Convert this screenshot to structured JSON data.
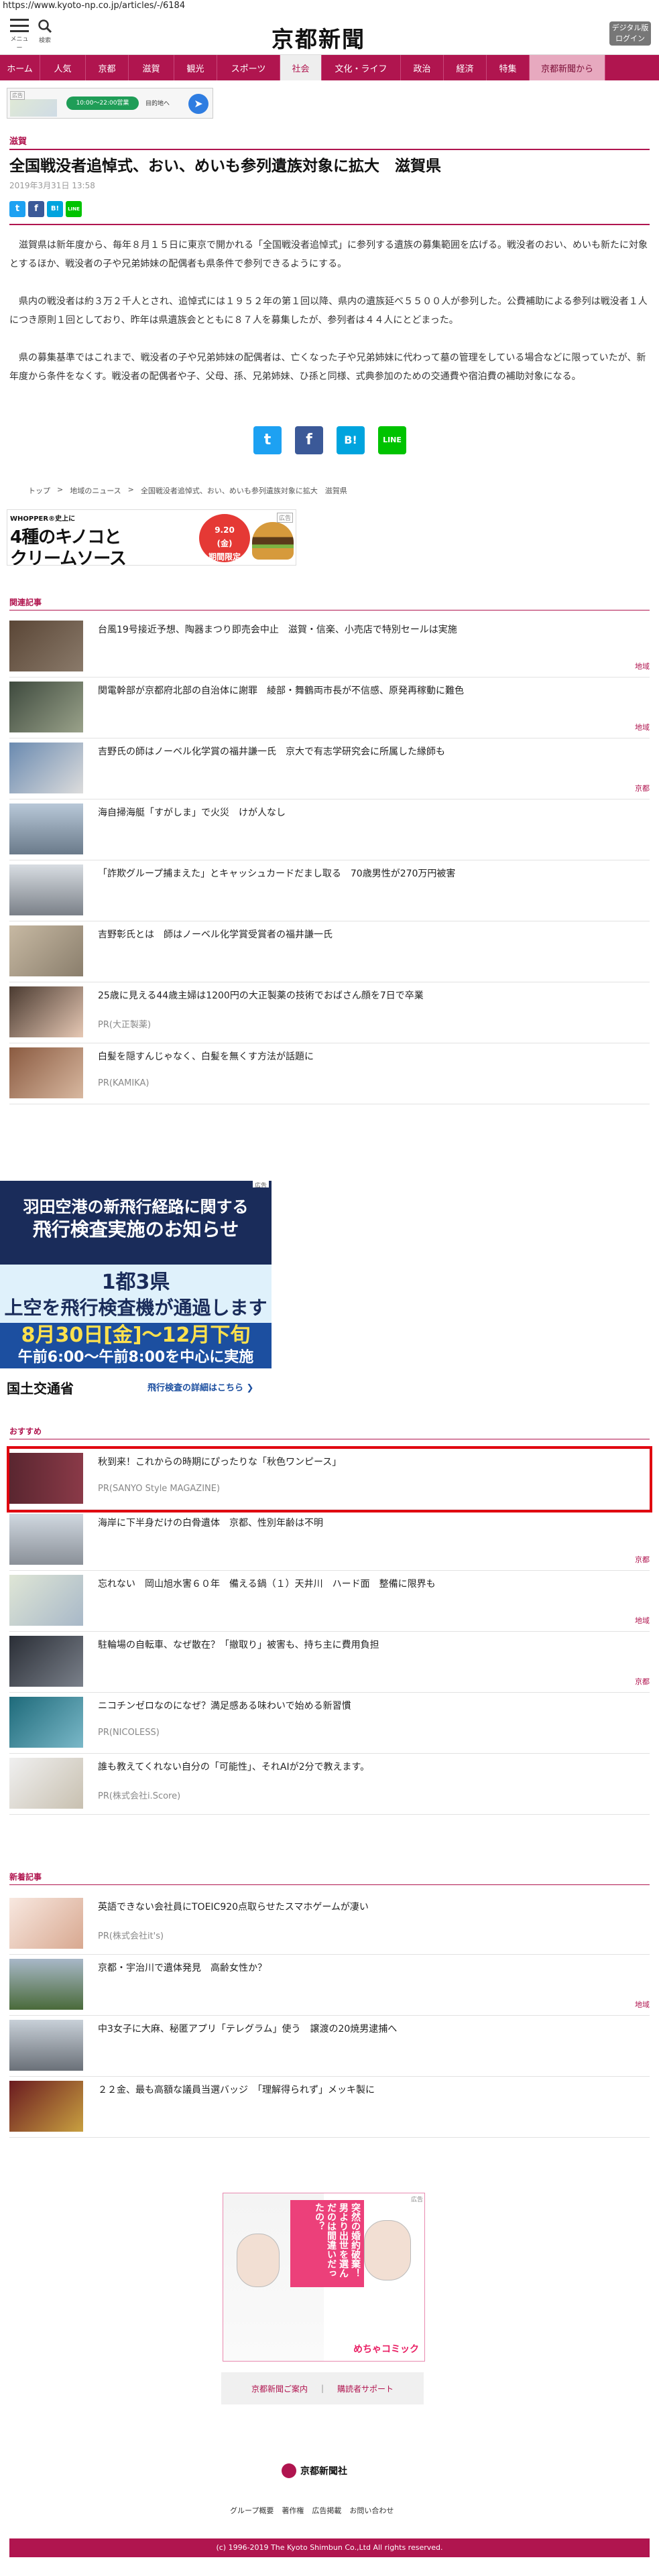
{
  "browser": {
    "url": "https://www.kyoto-np.co.jp/articles/-/6184"
  },
  "header": {
    "menu_label": "メニュー",
    "search_label": "検索",
    "logo": "京都新聞",
    "digital_line1": "デジタル版",
    "digital_line2": "ログイン"
  },
  "nav": [
    "ホーム",
    "人気",
    "京都",
    "滋賀",
    "観光",
    "スポーツ",
    "社会",
    "文化・ライフ",
    "政治",
    "経済",
    "特集",
    "京都新聞から"
  ],
  "nav_active": "社会",
  "top_ad": {
    "label": "広告",
    "pill": "10:00〜22:00営業",
    "address": "目的地へ"
  },
  "article": {
    "category": "滋賀",
    "title": "全国戦没者追悼式、おい、めいも参列遺族対象に拡大　滋賀県",
    "date": "2019年3月31日 13:58",
    "paragraphs": [
      "滋賀県は新年度から、毎年８月１５日に東京で開かれる「全国戦没者追悼式」に参列する遺族の募集範囲を広げる。戦没者のおい、めいも新たに対象とするほか、戦没者の子や兄弟姉妹の配偶者も県条件で参列できるようにする。",
      "県内の戦没者は約３万２千人とされ、追悼式には１９５２年の第１回以降、県内の遺族延べ５５００人が参列した。公費補助による参列は戦没者１人につき原則１回としており、昨年は県遺族会とともに８７人を募集したが、参列者は４４人にとどまった。",
      "県の募集基準ではこれまで、戦没者の子や兄弟姉妹の配偶者は、亡くなった子や兄弟姉妹に代わって墓の管理をしている場合などに限っていたが、新年度から条件をなくす。戦没者の配偶者や子、父母、孫、兄弟姉妹、ひ孫と同様、式典参加のための交通費や宿泊費の補助対象になる。"
    ]
  },
  "share": {
    "twitter": "t",
    "facebook": "f",
    "hatena": "B!",
    "line": "LINE"
  },
  "breadcrumb": [
    "トップ",
    ">",
    "地域のニュース",
    ">",
    "全国戦没者追悼式、おい、めいも参列遺族対象に拡大　滋賀県"
  ],
  "burger_ad": {
    "line1": "WHOPPER®史上に",
    "line2": "4種のキノコと",
    "line3": "クリームソース",
    "seal": "9.20\n(金)\n期間限定",
    "tag": "広告"
  },
  "related": {
    "title": "関連記事",
    "items": [
      {
        "title": "台風19号接近予想、陶器まつり即売会中止　滋賀・信楽、小売店で特別セールは実施",
        "tag": "地域"
      },
      {
        "title": "関電幹部が京都府北部の自治体に謝罪　綾部・舞鶴両市長が不信感、原発再稼動に難色",
        "tag": "地域"
      },
      {
        "title": "吉野氏の師はノーベル化学賞の福井謙一氏　京大で有志学研究会に所属した縁師も",
        "tag": "京都"
      },
      {
        "title": "海自掃海艇「すがしま」で火災　けが人なし",
        "tag": ""
      },
      {
        "title": "「詐欺グループ捕まえた」とキャッシュカードだまし取る　70歳男性が270万円被害",
        "tag": ""
      },
      {
        "title": "吉野彰氏とは　師はノーベル化学賞受賞者の福井謙一氏",
        "tag": ""
      },
      {
        "title": "25歳に見える44歳主婦は1200円の大正製薬の技術でおばさん顔を7日で卒業",
        "pr": "PR(大正製薬)",
        "tag": ""
      },
      {
        "title": "白髪を隠すんじゃなく、白髪を無くす方法が話題に",
        "pr": "PR(KAMIKA)",
        "tag": ""
      }
    ]
  },
  "haneda_ad": {
    "tag": "広告",
    "line1": "羽田空港の新飛行経路に関する",
    "line2": "飛行検査実施のお知らせ",
    "line3": "1都3県",
    "line4": "上空を飛行検査機が通過します",
    "line5": "8月30日[金]〜12月下旬",
    "line6": "午前6:00〜午前8:00を中心に実施",
    "ministry": "国土交通省",
    "more": "飛行検査の詳細はこちら ❯"
  },
  "recommend": {
    "title": "おすすめ",
    "items": [
      {
        "title": "秋到来！これからの時期にぴったりな「秋色ワンピース」",
        "pr": "PR(SANYO Style MAGAZINE)",
        "tag": ""
      },
      {
        "title": "海岸に下半身だけの白骨遺体　京都、性別年齢は不明",
        "tag": "京都"
      },
      {
        "title": "忘れない　岡山旭水害６０年　備える鍋（１）天井川　ハード面　整備に限界も",
        "tag": "地域"
      },
      {
        "title": "駐輪場の自転車、なぜ散在？「撤取り」被害も、持ち主に費用負担",
        "tag": "京都"
      },
      {
        "title": "ニコチンゼロなのになぜ？満足感ある味わいで始める新習慣",
        "pr": "PR(NICOLESS)",
        "tag": ""
      },
      {
        "title": "誰も教えてくれない自分の「可能性」、それAIが2分で教えます。",
        "pr": "PR(株式会社i.Score)",
        "tag": ""
      }
    ]
  },
  "latest": {
    "title": "新着記事",
    "items": [
      {
        "title": "英語できない会社員にTOEIC920点取らせたスマホゲームが凄い",
        "pr": "PR(株式会社it's)",
        "tag": ""
      },
      {
        "title": "京都・宇治川で遺体発見　高齢女性か？",
        "tag": "地域"
      },
      {
        "title": "中3女子に大麻、秘匿アプリ「テレグラム」使う　譲渡の20焼男逮捕へ",
        "tag": ""
      },
      {
        "title": "２２金、最も高額な議員当選バッジ　「理解得られず」メッキ製に",
        "tag": ""
      }
    ]
  },
  "manga_ad": {
    "tag": "広告",
    "banner": "突然の婚約破棄！男より出世を選んだのは間違いだったの？",
    "comic": "めちゃコミック"
  },
  "footer": {
    "link1": "京都新聞ご案内",
    "link2": "購読者サポート",
    "logo": "京都新聞社",
    "nav": [
      "グループ概要",
      "著作権",
      "広告掲載",
      "お問い合わせ"
    ],
    "copyright": "(c) 1996-2019 The Kyoto Shimbun Co.,Ltd All rights reserved."
  },
  "colors": {
    "brand": "#b0154f",
    "highlight": "#e0000f"
  }
}
